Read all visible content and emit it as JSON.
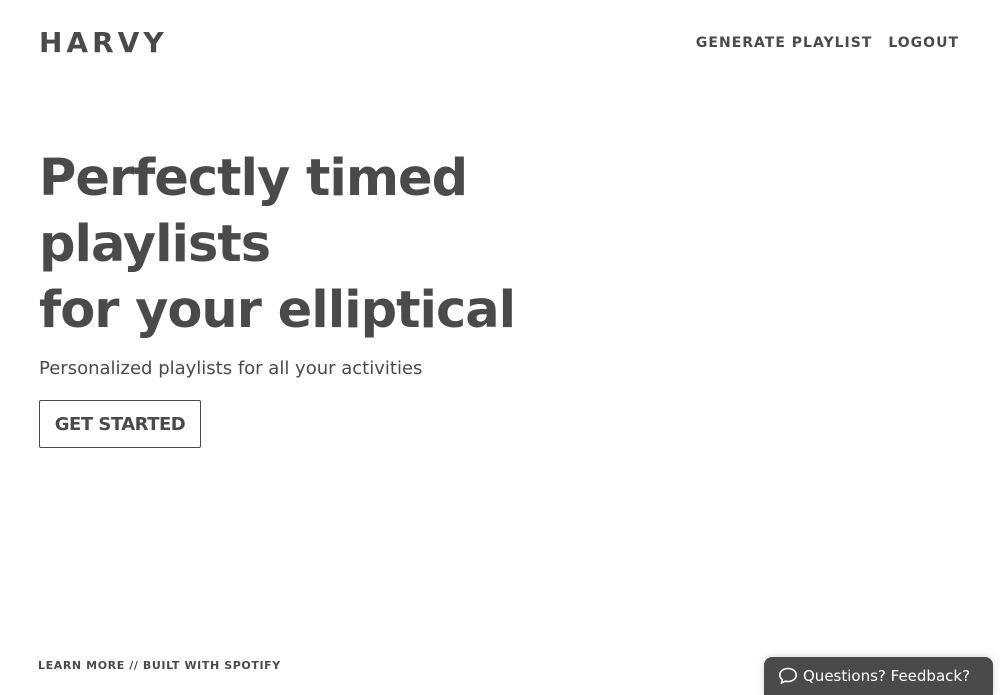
{
  "brand": {
    "logo_text": "HARVY"
  },
  "nav": {
    "items": [
      {
        "label": "GENERATE PLAYLIST"
      },
      {
        "label": "LOGOUT"
      }
    ]
  },
  "hero": {
    "title_lines": [
      "Perfectly timed",
      "playlists",
      "for your elliptical"
    ],
    "subtitle": "Personalized playlists for all your activities",
    "cta_label": "GET STARTED"
  },
  "footer": {
    "link_text": "LEARN MORE // BUILT WITH SPOTIFY"
  },
  "feedback": {
    "label": "Questions? Feedback?",
    "icon": "speech-bubble-icon"
  },
  "colors": {
    "text": "#4a4a4a",
    "background": "#ffffff",
    "feedback_bg": "#4a4a4a"
  }
}
